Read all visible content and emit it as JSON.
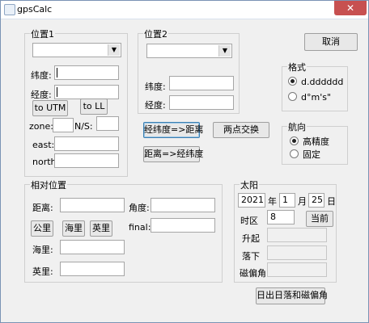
{
  "window": {
    "title": "gpsCalc",
    "close_glyph": "✕"
  },
  "cancel_button": "取消",
  "pos1": {
    "legend": "位置1",
    "lat_label": "纬度:",
    "lon_label": "经度:",
    "to_utm": "to UTM",
    "to_ll": "to LL",
    "zone_label": "zone:",
    "ns_label": "N/S:",
    "east_label": "east:",
    "north_label": "north:"
  },
  "pos2": {
    "legend": "位置2",
    "lat_label": "纬度:",
    "lon_label": "经度:"
  },
  "middle": {
    "latlon_to_dist": "经纬度=>距离",
    "swap_points": "两点交换",
    "dist_to_latlon": "距离=>经纬度"
  },
  "format": {
    "legend": "格式",
    "opt1": "d.dddddd",
    "opt2": "d°m's\""
  },
  "heading": {
    "legend": "航向",
    "opt1": "高精度",
    "opt2": "固定"
  },
  "relative": {
    "legend": "相对位置",
    "dist_label": "距离:",
    "angle_label": "角度:",
    "btn_km": "公里",
    "btn_nmi": "海里",
    "btn_mile": "英里",
    "final_label": "final:",
    "nmi_label": "海里:",
    "mile_label": "英里:"
  },
  "sun": {
    "legend": "太阳",
    "year": "2021",
    "year_label": "年",
    "month": "1",
    "month_label": "月",
    "day": "25",
    "day_label": "日",
    "tz_label": "时区",
    "tz": "8",
    "now_button": "当前",
    "rise_label": "升起",
    "set_label": "落下",
    "decl_label": "磁偏角"
  },
  "bottom_button": "日出日落和磁偏角"
}
